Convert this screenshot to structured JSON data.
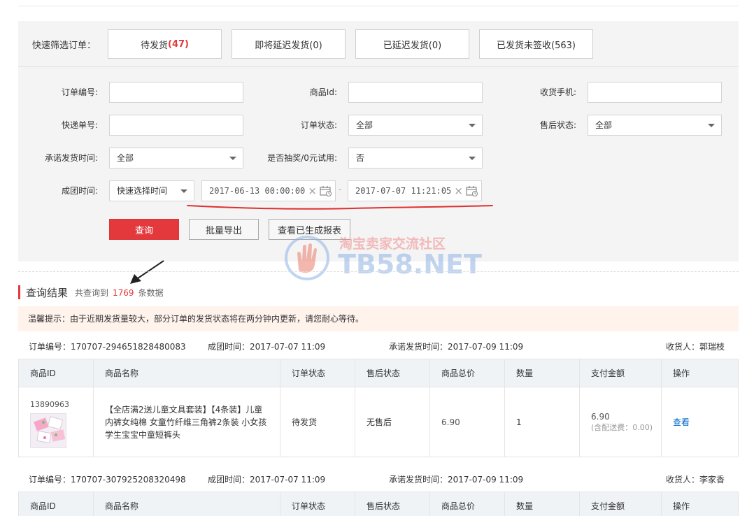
{
  "quick_filter": {
    "label": "快速筛选订单：",
    "buttons": [
      {
        "label": "待发货",
        "count": "(47)"
      },
      {
        "label": "即将延迟发货(0)"
      },
      {
        "label": "已延迟发货(0)"
      },
      {
        "label": "已发货未签收(563)"
      }
    ]
  },
  "filters": {
    "order_no_label": "订单编号:",
    "product_id_label": "商品Id:",
    "phone_label": "收货手机:",
    "tracking_label": "快递单号:",
    "order_status_label": "订单状态:",
    "order_status_value": "全部",
    "after_sale_label": "售后状态:",
    "after_sale_value": "全部",
    "promise_time_label": "承诺发货时间:",
    "promise_time_value": "全部",
    "lottery_label": "是否抽奖/0元试用:",
    "lottery_value": "否",
    "group_time_label": "成团时间:",
    "group_time_quick": "快速选择时间",
    "date_start": "2017-06-13 00:00:00",
    "date_end": "2017-07-07 11:21:05",
    "date_sep": "-"
  },
  "actions": {
    "query": "查询",
    "export": "批量导出",
    "reports": "查看已生成报表"
  },
  "watermark": {
    "line1": "淘宝卖家交流社区",
    "line2": "TB58.NET"
  },
  "result": {
    "title": "查询结果",
    "prefix": "共查询到",
    "count": "1769",
    "suffix": "条数据"
  },
  "tip": "温馨提示：由于近期发货量较大，部分订单的发货状态将在两分钟内更新，请您耐心等待。",
  "table_headers": [
    "商品ID",
    "商品名称",
    "订单状态",
    "售后状态",
    "商品总价",
    "数量",
    "支付金额",
    "操作"
  ],
  "orders": [
    {
      "order_no": "订单编号：170707-294651828480083",
      "group_time": "成团时间：2017-07-07 11:09",
      "promise_time": "承诺发货时间：2017-07-09 11:09",
      "receiver": "收货人：郭瑞枝",
      "product_id": "13890963",
      "product_name": "【全店满2送儿童文具套装】【4条装】儿童内裤女纯棉 女童竹纤维三角裤2条装 小女孩学生宝宝中童短裤头",
      "status": "待发货",
      "after_sale": "无售后",
      "total": "6.90",
      "qty": "1",
      "paid": "6.90",
      "shipping": "(含配送费：0.00)",
      "action": "查看"
    },
    {
      "order_no": "订单编号：170707-307925208320498",
      "group_time": "成团时间：2017-07-07 11:09",
      "promise_time": "承诺发货时间：2017-07-09 11:09",
      "receiver": "收货人：李家香"
    }
  ],
  "colors": {
    "accent": "#e4393c",
    "link": "#0066cc",
    "panel": "#f4f4f4",
    "tip_bg": "#fff3ec"
  }
}
